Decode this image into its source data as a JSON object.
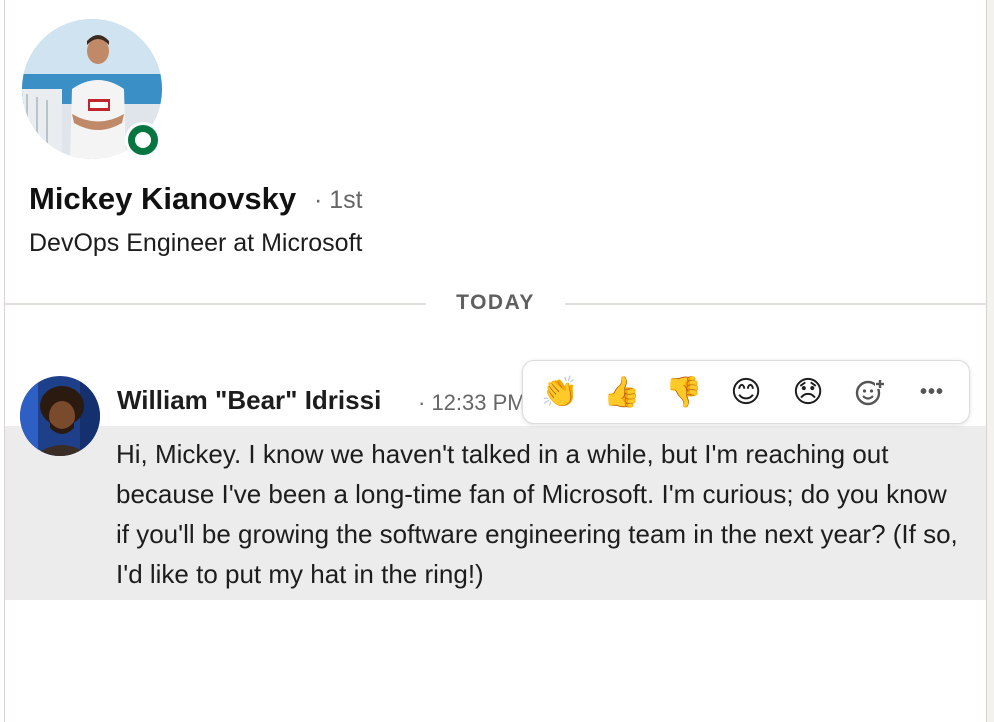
{
  "profile": {
    "name": "Mickey Kianovsky",
    "degree": "· 1st",
    "headline": "DevOps Engineer at Microsoft",
    "status": "online"
  },
  "divider": {
    "label": "TODAY"
  },
  "message": {
    "sender": "William \"Bear\" Idrissi",
    "time": "· 12:33 PM",
    "body": "Hi, Mickey. I know we haven't talked in a while, but I'm reaching out because I've been a long-time fan of Microsoft. I'm curious; do you know if you'll be growing the software engineering team in the next year? (If so, I'd like to put my hat in the ring!)"
  },
  "reactions": {
    "clap": "👏",
    "thumbs_up": "👍",
    "thumbs_down": "👎",
    "smile": "😊",
    "sad": "😞",
    "more": "•••"
  },
  "colors": {
    "online_green": "#057642",
    "message_highlight": "#ececec"
  }
}
